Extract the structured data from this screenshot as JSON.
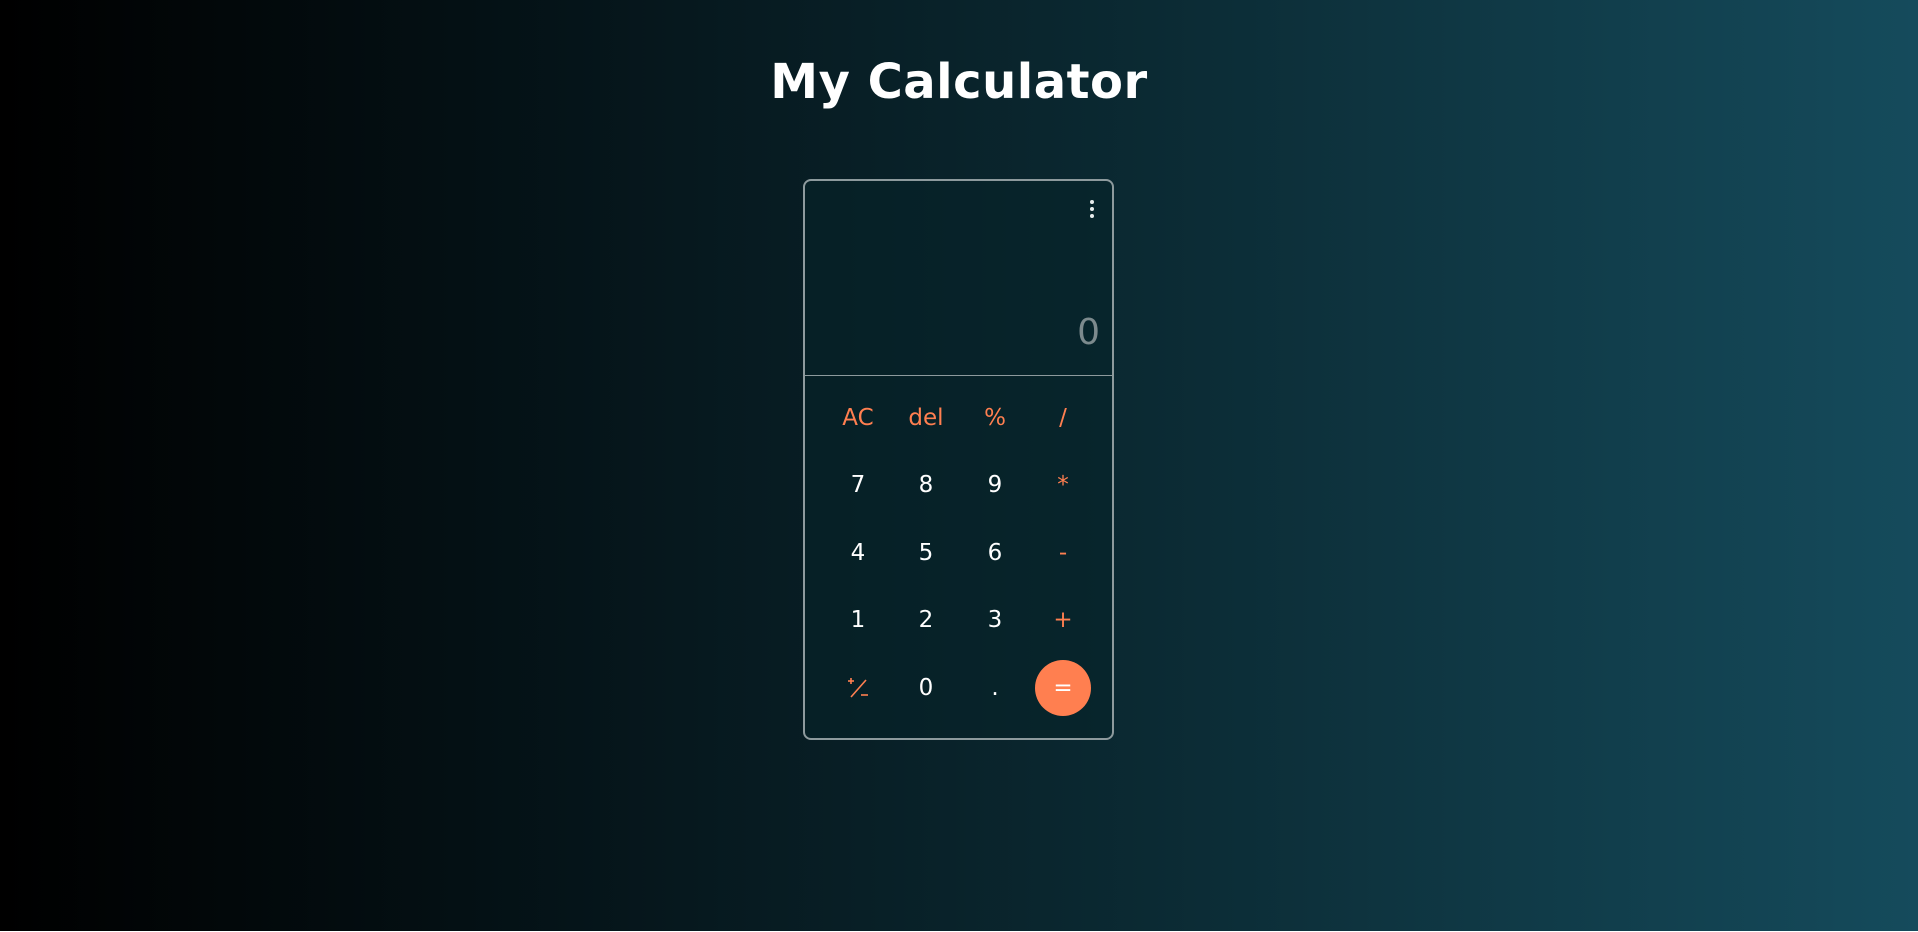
{
  "app": {
    "title": "My Calculator"
  },
  "display": {
    "value": "0"
  },
  "keypad": {
    "row1": [
      "AC",
      "del",
      "%",
      "/"
    ],
    "row2": [
      "7",
      "8",
      "9",
      "*"
    ],
    "row3": [
      "4",
      "5",
      "6",
      "-"
    ],
    "row4": [
      "1",
      "2",
      "3",
      "+"
    ],
    "row5": [
      "+/-",
      "0",
      ".",
      "="
    ]
  },
  "icons": {
    "menu": "more-vertical-icon",
    "plus_minus": "plus-minus-icon"
  },
  "colors": {
    "accent": "#ff7f50",
    "text": "#ffffff",
    "display_text": "#7c8a8d",
    "border": "#8d9a9d"
  }
}
